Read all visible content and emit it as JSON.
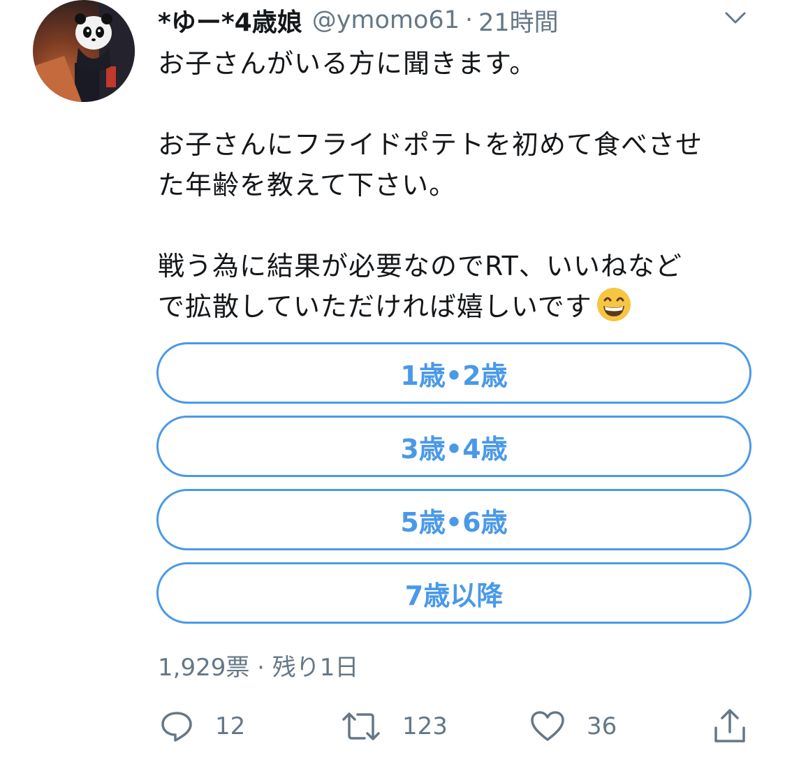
{
  "tweet": {
    "display_name": "*ゆー*4歳娘",
    "handle": "@ymomo61",
    "separator": "·",
    "time": "21時間",
    "lines": {
      "l1": "お子さんがいる方に聞きます。",
      "l2": "お子さんにフライドポテトを初めて食べさせ",
      "l3": "た年齢を教えて下さい。",
      "l4": "戦う為に結果が必要なのでRT、いいねなど",
      "l5": "で拡散していただければ嬉しいです"
    },
    "emoji": "grinning-face-with-smiling-eyes"
  },
  "poll": {
    "options": [
      "1歳•2歳",
      "3歳•4歳",
      "5歳•6歳",
      "7歳以降"
    ],
    "meta": "1,929票 · 残り1日"
  },
  "actions": {
    "reply_count": "12",
    "retweet_count": "123",
    "like_count": "36"
  },
  "colors": {
    "accent": "#4a99e9",
    "secondary_text": "#657786",
    "primary_text": "#14171a"
  }
}
